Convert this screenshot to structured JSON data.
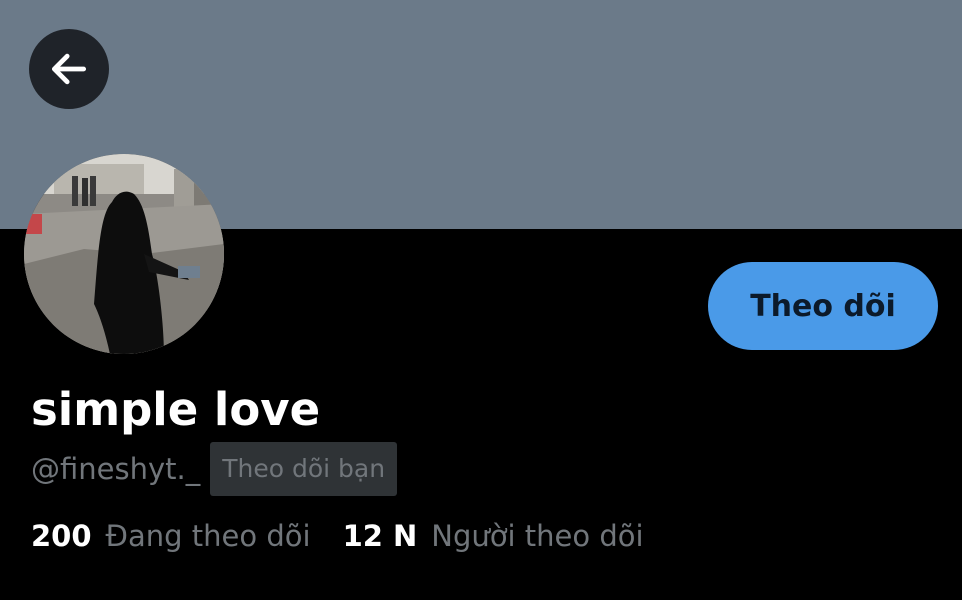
{
  "header": {
    "back_icon": "arrow-left-icon"
  },
  "colors": {
    "banner": "#6b7a89",
    "accent": "#4a9ae8",
    "background": "#000000",
    "secondary_text": "#71767b"
  },
  "profile": {
    "display_name": "simple love",
    "handle": "@fineshyt._",
    "follows_you_badge": "Theo dõi bạn",
    "follow_button_label": "Theo dõi"
  },
  "stats": {
    "following_count": "200",
    "following_label": "Đang theo dõi",
    "followers_count": "12 N",
    "followers_label": "Người theo dõi"
  }
}
